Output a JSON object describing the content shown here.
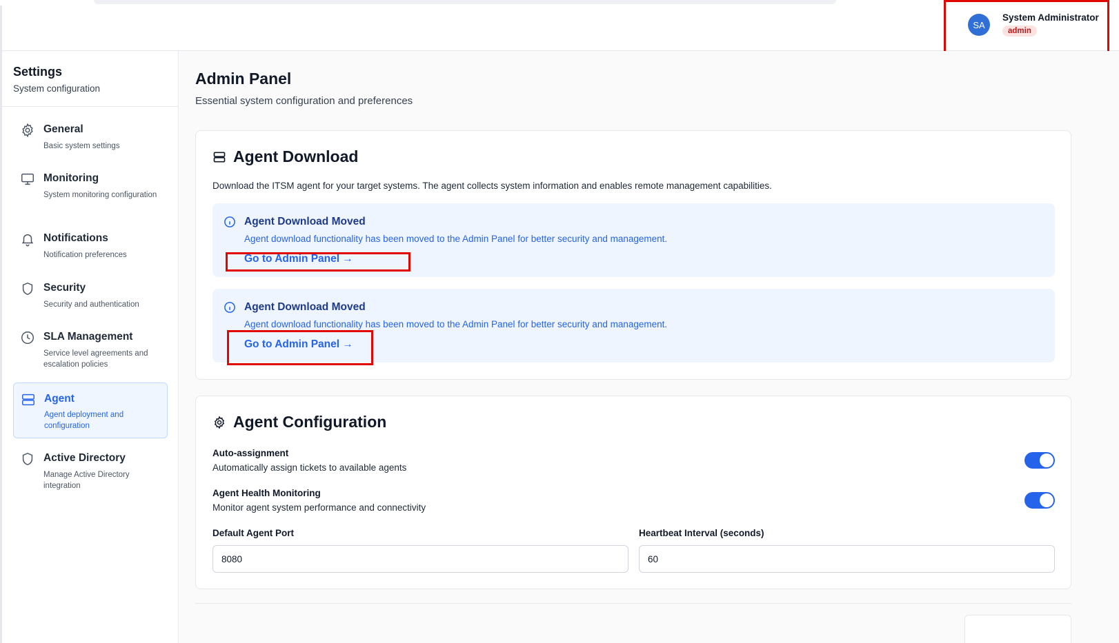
{
  "user": {
    "initials": "SA",
    "name": "System Administrator",
    "role": "admin"
  },
  "sidebar": {
    "title": "Settings",
    "subtitle": "System configuration",
    "items": [
      {
        "label": "General",
        "desc": "Basic system settings",
        "icon": "gear-icon"
      },
      {
        "label": "Monitoring",
        "desc": "System monitoring configuration",
        "icon": "monitor-icon"
      },
      {
        "label": "Notifications",
        "desc": "Notification preferences",
        "icon": "bell-icon"
      },
      {
        "label": "Security",
        "desc": "Security and authentication",
        "icon": "shield-icon"
      },
      {
        "label": "SLA Management",
        "desc": "Service level agreements and escalation policies",
        "icon": "clock-icon"
      },
      {
        "label": "Agent",
        "desc": "Agent deployment and configuration",
        "icon": "server-icon",
        "active": true
      },
      {
        "label": "Active Directory",
        "desc": "Manage Active Directory integration",
        "icon": "shield-icon"
      }
    ]
  },
  "main": {
    "title": "Admin Panel",
    "subtitle": "Essential system configuration and preferences"
  },
  "agent_download": {
    "title": "Agent Download",
    "description": "Download the ITSM agent for your target systems. The agent collects system information and enables remote management capabilities.",
    "notices": [
      {
        "title": "Agent Download Moved",
        "text": "Agent download functionality has been moved to the Admin Panel for better security and management.",
        "link": "Go to Admin Panel →"
      },
      {
        "title": "Agent Download Moved",
        "text": "Agent download functionality has been moved to the Admin Panel for better security and management.",
        "link": "Go to Admin Panel →"
      }
    ]
  },
  "agent_config": {
    "title": "Agent Configuration",
    "settings": [
      {
        "title": "Auto-assignment",
        "desc": "Automatically assign tickets to available agents",
        "enabled": true
      },
      {
        "title": "Agent Health Monitoring",
        "desc": "Monitor agent system performance and connectivity",
        "enabled": true
      }
    ],
    "port_label": "Default Agent Port",
    "port_value": "8080",
    "heartbeat_label": "Heartbeat Interval (seconds)",
    "heartbeat_value": "60"
  },
  "colors": {
    "accent": "#2563eb",
    "highlight": "#e10600",
    "notice_bg": "#eef5fe"
  }
}
